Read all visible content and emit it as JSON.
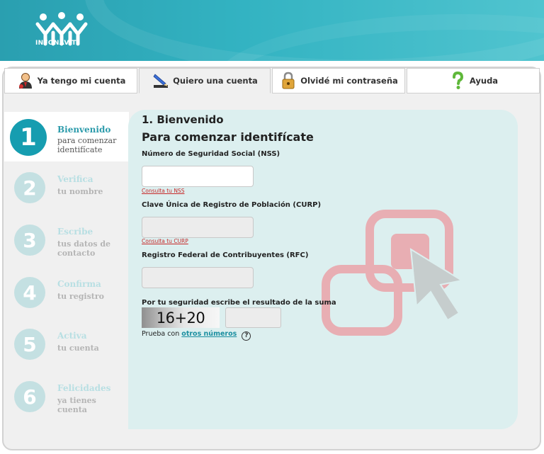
{
  "brand": {
    "name": "INFONAVIT"
  },
  "tabs": [
    {
      "label": "Ya tengo mi cuenta",
      "icon": "user-icon",
      "active": false
    },
    {
      "label": "Quiero una cuenta",
      "icon": "pencil-icon",
      "active": true
    },
    {
      "label": "Olvidé mi contraseña",
      "icon": "lock-icon",
      "active": false
    },
    {
      "label": "Ayuda",
      "icon": "question-icon",
      "active": false
    }
  ],
  "steps": [
    {
      "number": "1",
      "title": "Bienvenido",
      "subtitle": "para comenzar identifícate",
      "active": true
    },
    {
      "number": "2",
      "title": "Verifica",
      "subtitle": "tu nombre",
      "active": false
    },
    {
      "number": "3",
      "title": "Escribe",
      "subtitle": "tus datos de contacto",
      "active": false
    },
    {
      "number": "4",
      "title": "Confirma",
      "subtitle": "tu registro",
      "active": false
    },
    {
      "number": "5",
      "title": "Activa",
      "subtitle": "tu cuenta",
      "active": false
    },
    {
      "number": "6",
      "title": "Felicidades",
      "subtitle": "ya tienes cuenta",
      "active": false
    }
  ],
  "form": {
    "title": "1. Bienvenido",
    "subtitle": "Para comenzar identifícate",
    "nss": {
      "label": "Número de Seguridad Social (NSS)",
      "value": "",
      "link": "Consulta tu NSS"
    },
    "curp": {
      "label": "Clave Única de Registro de Población (CURP)",
      "value": "",
      "link": "Consulta tu CURP"
    },
    "rfc": {
      "label": "Registro Federal de Contribuyentes (RFC)",
      "value": ""
    },
    "captcha": {
      "label": "Por tu seguridad escribe el resultado de la suma",
      "expression": "16+20",
      "value": "",
      "retry_prefix": "Prueba con",
      "retry_link": "otros números",
      "help_glyph": "?"
    }
  },
  "colors": {
    "accent": "#169db0",
    "panel": "#dcefef",
    "link_red": "#c62828",
    "step_inactive": "#c4e0e2"
  }
}
